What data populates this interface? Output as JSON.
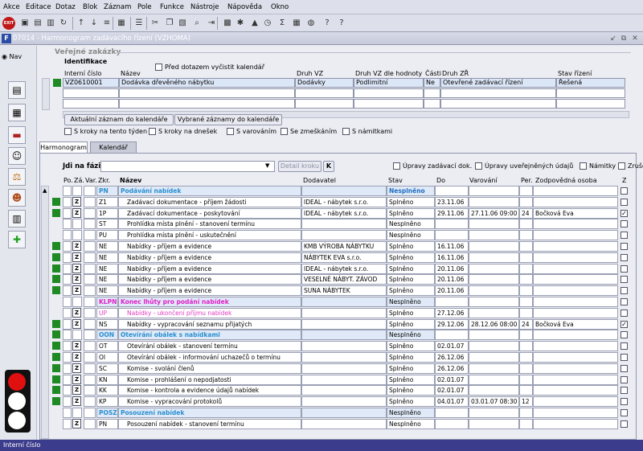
{
  "menu": [
    "Akce",
    "Editace",
    "Dotaz",
    "Blok",
    "Záznam",
    "Pole",
    "Funkce",
    "Nástroje",
    "Nápověda",
    "Okno"
  ],
  "window": {
    "title": "07014 - Harmonogram zadávacího řízení (VZHOMA)"
  },
  "nav_label": "Nav",
  "section_title": "Veřejné zakázky",
  "identifikace": "Identifikace",
  "clear_checkbox_label": "Před dotazem vyčistit kalendář",
  "headers": {
    "interni": "Interní číslo",
    "nazev": "Název",
    "druh_vz": "Druh VZ",
    "druh_hodnota": "Druh VZ dle hodnoty",
    "casti": "Části",
    "druh_zr": "Druh ZŘ",
    "stav_rizeni": "Stav řízení"
  },
  "record": {
    "interni": "VZ0610001",
    "nazev": "Dodávka dřevěného nábytku",
    "druh_vz": "Dodávky",
    "druh_hodnota": "Podlimitní",
    "casti": "Ne",
    "druh_zr": "Otevřené zadávací řízení",
    "stav_rizeni": "Řešená"
  },
  "buttons": {
    "aktualni": "Aktuální záznam do kalendáře",
    "vybrane": "Vybrané záznamy do kalendáře"
  },
  "filters": [
    "S kroky na tento týden",
    "S kroky na dnešek",
    "S varováním",
    "Se zmeškáním",
    "S námitkami"
  ],
  "tabs": [
    "Harmonogram",
    "Kalendář"
  ],
  "jdi_label": "Jdi na fázi",
  "detail_btn": "Detail kroku",
  "k_btn": "K",
  "grid_checks": [
    "Úpravy zadávací dok.",
    "Úpravy uveřejněných údajů",
    "Námitky",
    "Zrušení ZŘ"
  ],
  "grid_headers": {
    "po": "Po.",
    "za": "Zá.",
    "var": "Var.",
    "zkr": "Zkr.",
    "nazev": "Název",
    "dodavatel": "Dodavatel",
    "stav": "Stav",
    "do": "Do",
    "varovani": "Varování",
    "per": "Per.",
    "osoba": "Zodpovědná osoba",
    "z": "Z"
  },
  "rows": [
    {
      "phase": true,
      "color": "#2a8fd0",
      "zkr": "PN",
      "nazev": "Podávání nabídek",
      "dod": "",
      "stav": "Nesplněno",
      "stav_hl": true,
      "do": "",
      "var": "",
      "per": "",
      "osoba": "",
      "z": false,
      "green": false,
      "zchk": false
    },
    {
      "phase": false,
      "zkr": "Z1",
      "nazev": "Zadávací dokumentace - příjem žádosti",
      "dod": "IDEAL - nábytek s.r.o.",
      "stav": "Splněno",
      "do": "23.11.06",
      "var": "",
      "per": "",
      "osoba": "",
      "z": false,
      "green": true,
      "zchk": true
    },
    {
      "phase": false,
      "zkr": "1P",
      "nazev": "Zadávací dokumentace - poskytování",
      "dod": "IDEAL - nábytek s.r.o.",
      "stav": "Splněno",
      "do": "29.11.06",
      "var": "27.11.06 09:00",
      "per": "24",
      "osoba": "Bočková Eva",
      "z": true,
      "green": true,
      "zchk": true
    },
    {
      "phase": false,
      "zkr": "ST",
      "nazev": "Prohlídka místa plnění - stanovení termínu",
      "dod": "",
      "stav": "Nesplněno",
      "do": "",
      "var": "",
      "per": "",
      "osoba": "",
      "z": false,
      "green": false,
      "zchk": false
    },
    {
      "phase": false,
      "zkr": "PU",
      "nazev": "Prohlídka místa plnění - uskutečnění",
      "dod": "",
      "stav": "Nesplněno",
      "do": "",
      "var": "",
      "per": "",
      "osoba": "",
      "z": false,
      "green": false,
      "zchk": false
    },
    {
      "phase": false,
      "zkr": "NE",
      "nazev": "Nabídky - příjem a evidence",
      "dod": "KMB VÝROBA NÁBYTKU",
      "stav": "Splněno",
      "do": "16.11.06",
      "var": "",
      "per": "",
      "osoba": "",
      "z": false,
      "green": true,
      "zchk": true
    },
    {
      "phase": false,
      "zkr": "NE",
      "nazev": "Nabídky - příjem a evidence",
      "dod": "NÁBYTEK EVA s.r.o.",
      "stav": "Splněno",
      "do": "16.11.06",
      "var": "",
      "per": "",
      "osoba": "",
      "z": false,
      "green": true,
      "zchk": true
    },
    {
      "phase": false,
      "zkr": "NE",
      "nazev": "Nabídky - příjem a evidence",
      "dod": "IDEAL - nábytek s.r.o.",
      "stav": "Splněno",
      "do": "20.11.06",
      "var": "",
      "per": "",
      "osoba": "",
      "z": false,
      "green": true,
      "zchk": true
    },
    {
      "phase": false,
      "zkr": "NE",
      "nazev": "Nabídky - příjem a evidence",
      "dod": "VESELNÉ NÁBYT. ZÁVOD",
      "stav": "Splněno",
      "do": "20.11.06",
      "var": "",
      "per": "",
      "osoba": "",
      "z": false,
      "green": true,
      "zchk": true
    },
    {
      "phase": false,
      "zkr": "NE",
      "nazev": "Nabídky - příjem a evidence",
      "dod": "SUNA NÁBYTEK",
      "stav": "Splněno",
      "do": "20.11.06",
      "var": "",
      "per": "",
      "osoba": "",
      "z": false,
      "green": true,
      "zchk": true
    },
    {
      "phase": true,
      "color": "#e020c8",
      "zkr": "KLPN",
      "nazev": "Konec lhůty pro podání nabídek",
      "dod": "",
      "stav": "Nesplněno",
      "do": "",
      "var": "",
      "per": "",
      "osoba": "",
      "z": false,
      "green": false,
      "zchk": false
    },
    {
      "phase": false,
      "pink": true,
      "zkr": "UP",
      "nazev": "Nabídky - ukončení příjmu nabídek",
      "dod": "",
      "stav": "Splněno",
      "do": "27.12.06",
      "var": "",
      "per": "",
      "osoba": "",
      "z": false,
      "green": false,
      "zchk": true
    },
    {
      "phase": false,
      "zkr": "NS",
      "nazev": "Nabídky - vypracování seznamu přijatých",
      "dod": "",
      "stav": "Splněno",
      "do": "29.12.06",
      "var": "28.12.06 08:00",
      "per": "24",
      "osoba": "Bočková Eva",
      "z": true,
      "green": true,
      "zchk": true
    },
    {
      "phase": true,
      "color": "#2a8fd0",
      "zkr": "OON",
      "nazev": "Otevírání obálek s nabídkami",
      "dod": "",
      "stav": "Nesplněno",
      "do": "",
      "var": "",
      "per": "",
      "osoba": "",
      "z": false,
      "green": true,
      "zchk": false
    },
    {
      "phase": false,
      "zkr": "OT",
      "nazev": "Otevírání obálek - stanovení termínu",
      "dod": "",
      "stav": "Splněno",
      "do": "02.01.07",
      "var": "",
      "per": "",
      "osoba": "",
      "z": false,
      "green": true,
      "zchk": true
    },
    {
      "phase": false,
      "zkr": "OI",
      "nazev": "Otevírání obálek - informování uchazečů o termínu",
      "dod": "",
      "stav": "Splněno",
      "do": "26.12.06",
      "var": "",
      "per": "",
      "osoba": "",
      "z": false,
      "green": true,
      "zchk": true
    },
    {
      "phase": false,
      "zkr": "SC",
      "nazev": "Komise - svolání členů",
      "dod": "",
      "stav": "Splněno",
      "do": "26.12.06",
      "var": "",
      "per": "",
      "osoba": "",
      "z": false,
      "green": true,
      "zchk": true
    },
    {
      "phase": false,
      "zkr": "KN",
      "nazev": "Komise - prohlášení o nepodjatosti",
      "dod": "",
      "stav": "Splněno",
      "do": "02.01.07",
      "var": "",
      "per": "",
      "osoba": "",
      "z": false,
      "green": true,
      "zchk": true
    },
    {
      "phase": false,
      "zkr": "KK",
      "nazev": "Komise - kontrola a evidence údajů nabídek",
      "dod": "",
      "stav": "Splněno",
      "do": "02.01.07",
      "var": "",
      "per": "",
      "osoba": "",
      "z": false,
      "green": true,
      "zchk": true
    },
    {
      "phase": false,
      "zkr": "KP",
      "nazev": "Komise - vypracování protokolů",
      "dod": "",
      "stav": "Splněno",
      "do": "04.01.07",
      "var": "03.01.07 08:30",
      "per": "12",
      "osoba": "",
      "z": false,
      "green": true,
      "zchk": true
    },
    {
      "phase": true,
      "color": "#2a8fd0",
      "zkr": "POSZ",
      "nazev": "Posouzení nabídek",
      "dod": "",
      "stav": "Nesplněno",
      "do": "",
      "var": "",
      "per": "",
      "osoba": "",
      "z": false,
      "green": false,
      "zchk": false
    },
    {
      "phase": false,
      "zkr": "PN",
      "nazev": "Posouzení nabídek - stanovení termínu",
      "dod": "",
      "stav": "Nesplněno",
      "do": "",
      "var": "",
      "per": "",
      "osoba": "",
      "z": false,
      "green": false,
      "zchk": true
    }
  ],
  "status": "Interní číslo"
}
